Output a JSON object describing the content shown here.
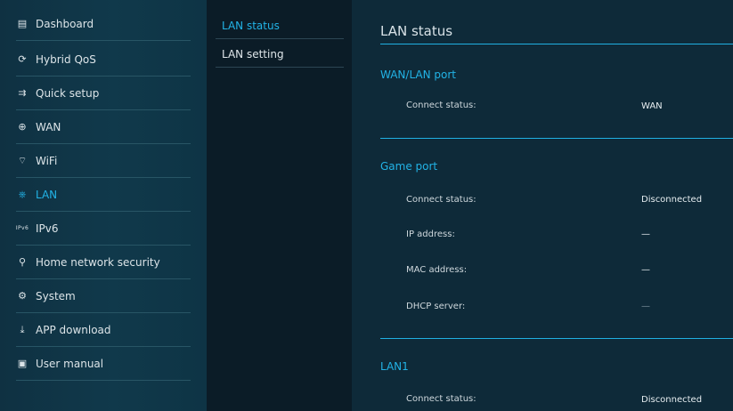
{
  "sidebar": {
    "items": [
      {
        "label": "Dashboard",
        "icon": "dashboard-icon",
        "glyph": "▤"
      },
      {
        "label": "Hybrid QoS",
        "icon": "qos-icon",
        "glyph": "⟳"
      },
      {
        "label": "Quick setup",
        "icon": "quick-setup-icon",
        "glyph": "⇉"
      },
      {
        "label": "WAN",
        "icon": "globe-icon",
        "glyph": "⊕"
      },
      {
        "label": "WiFi",
        "icon": "wifi-icon",
        "glyph": "⌔"
      },
      {
        "label": "LAN",
        "icon": "lan-icon",
        "glyph": "⎈"
      },
      {
        "label": "IPv6",
        "icon": "ipv6-icon",
        "glyph": "IPv6"
      },
      {
        "label": "Home network security",
        "icon": "security-icon",
        "glyph": "⚲"
      },
      {
        "label": "System",
        "icon": "system-icon",
        "glyph": "⚙"
      },
      {
        "label": "APP download",
        "icon": "download-icon",
        "glyph": "⤓"
      },
      {
        "label": "User manual",
        "icon": "manual-icon",
        "glyph": "▣"
      }
    ],
    "active_index": 5
  },
  "submenu": {
    "items": [
      {
        "label": "LAN status"
      },
      {
        "label": "LAN setting"
      }
    ],
    "active_index": 0
  },
  "main": {
    "title": "LAN status",
    "sections": [
      {
        "title": "WAN/LAN port",
        "rows": [
          {
            "label": "Connect status:",
            "value": "WAN"
          }
        ]
      },
      {
        "title": "Game port",
        "rows": [
          {
            "label": "Connect status:",
            "value": "Disconnected"
          },
          {
            "label": "IP address:",
            "value": "—"
          },
          {
            "label": "MAC address:",
            "value": "—"
          },
          {
            "label": "DHCP server:",
            "value": "—"
          }
        ]
      },
      {
        "title": "LAN1",
        "rows": [
          {
            "label": "Connect status:",
            "value": "Disconnected"
          }
        ]
      }
    ]
  },
  "colors": {
    "accent": "#22b3e6",
    "sidebar_bg": "#10394b",
    "main_bg": "#0e2a39",
    "submenu_bg": "#0b1c27"
  }
}
